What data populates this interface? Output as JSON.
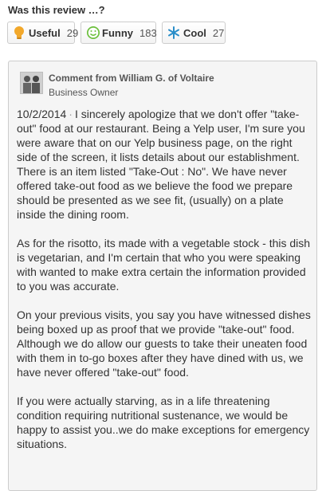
{
  "vote": {
    "title": "Was this review …?",
    "buttons": [
      {
        "label": "Useful",
        "count": "29",
        "icon": "lightbulb-icon",
        "color": "#f2a82b"
      },
      {
        "label": "Funny",
        "count": "183",
        "icon": "smiley-icon",
        "color": "#6bbf3b"
      },
      {
        "label": "Cool",
        "count": "27",
        "icon": "snowflake-icon",
        "color": "#2a8ec9"
      }
    ]
  },
  "comment": {
    "header": "Comment from William G. of Voltaire",
    "role": "Business Owner",
    "date": "10/2/2014",
    "separator": "·",
    "paragraphs": [
      "I sincerely apologize that we don't offer \"take-out\" food at our restaurant.  Being a Yelp user, I'm sure you were aware that on our Yelp business page, on the right side of the screen, it lists details about our establishment.  There is an item listed \"Take-Out : No\".  We have never offered take-out food as we believe the food we prepare should be presented as we see fit, (usually) on a plate inside the dining room.",
      "As for the risotto, its made with a vegetable stock - this dish is vegetarian, and I'm certain that who you were speaking with wanted to make extra certain the information provided to you was accurate.",
      "On your previous visits, you say you have witnessed dishes being boxed up as proof that we provide \"take-out\" food. Although we do allow our guests to take their uneaten food with them in to-go boxes after they have dined with us, we have never offered \"take-out\" food.",
      "If you were actually starving, as in a life threatening condition requiring nutritional sustenance, we would be happy to assist you..we do make exceptions for emergency situations."
    ]
  }
}
